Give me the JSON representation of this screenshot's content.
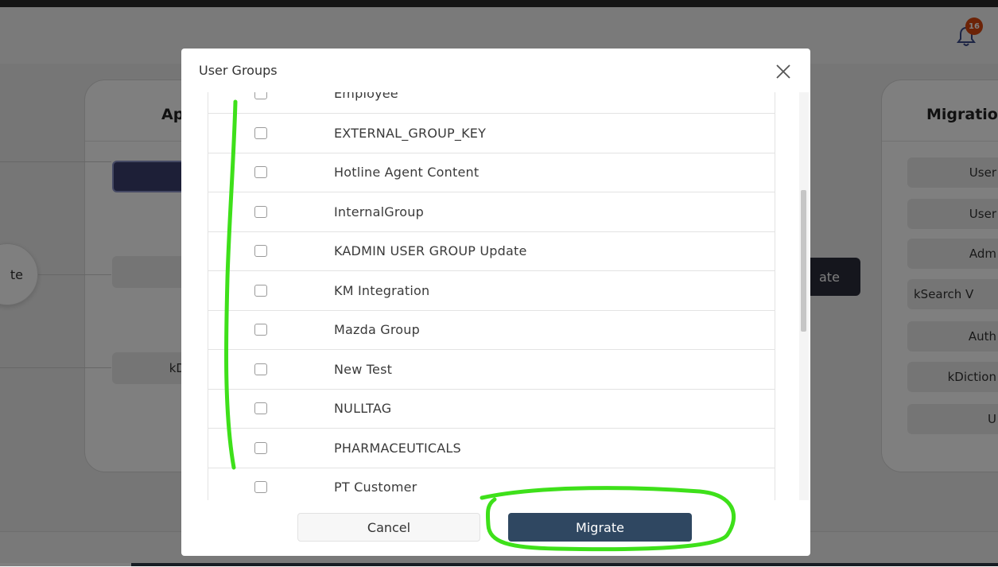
{
  "header": {
    "notification_count": "16"
  },
  "background": {
    "left_panel_title": "Ap",
    "right_panel_title": "Migratio",
    "circle_node_label": "te",
    "left_panel_pill_label": "kD",
    "dark_button_label": "ate",
    "right_panel_items": [
      "User",
      "User",
      "Adm",
      "kSearch V",
      "Auth",
      "kDiction",
      "U"
    ]
  },
  "modal": {
    "title": "User Groups",
    "groups": [
      "Employee",
      "EXTERNAL_GROUP_KEY",
      "Hotline Agent Content",
      "InternalGroup",
      "KADMIN USER GROUP Update",
      "KM Integration",
      "Mazda Group",
      "New Test",
      "NULLTAG",
      "PHARMACEUTICALS",
      "PT Customer"
    ],
    "cancel_label": "Cancel",
    "migrate_label": "Migrate"
  },
  "colors": {
    "accent": "#2f4761",
    "badge": "#d9460f",
    "annotation": "#3ee01a"
  }
}
